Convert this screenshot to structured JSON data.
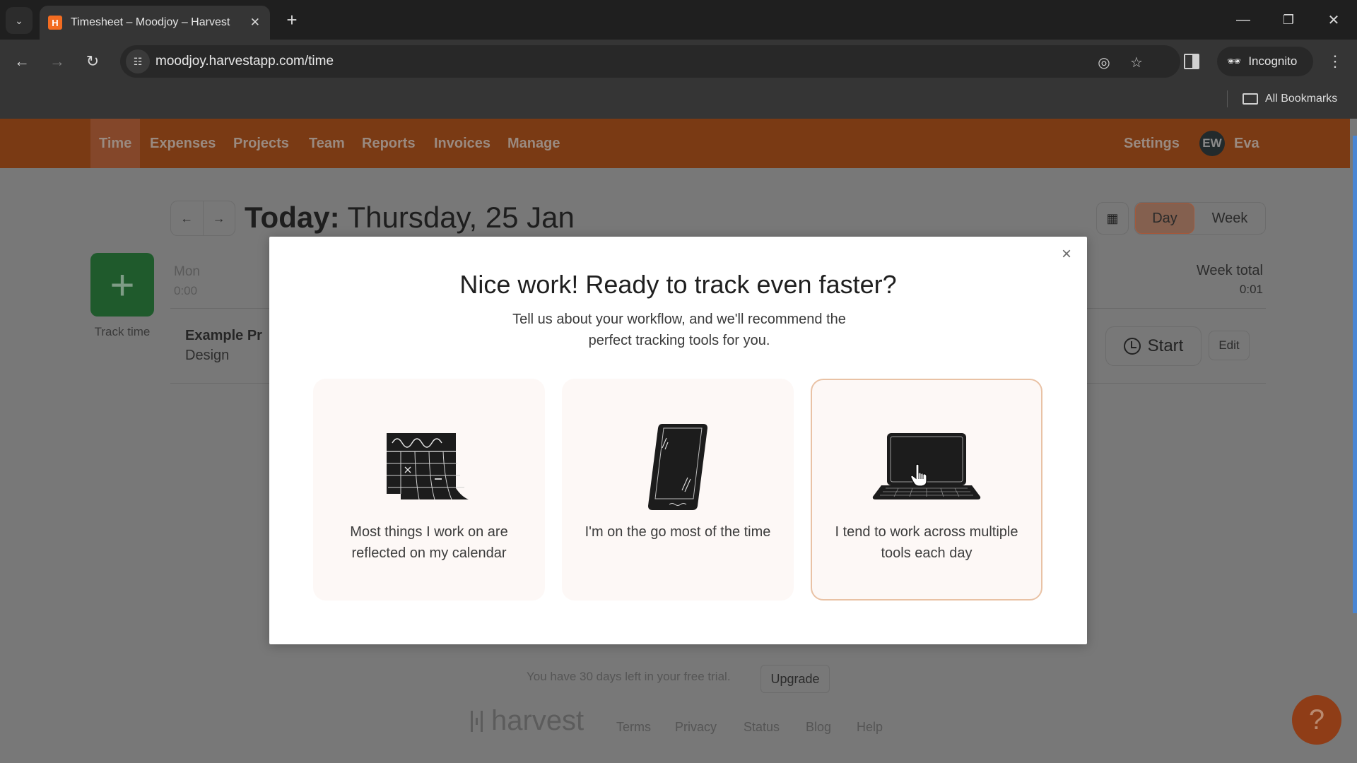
{
  "browser": {
    "tab_title": "Timesheet – Moodjoy – Harvest",
    "favicon_letter": "H",
    "url": "moodjoy.harvestapp.com/time",
    "incognito_label": "Incognito",
    "all_bookmarks_label": "All Bookmarks"
  },
  "app_nav": {
    "items": [
      {
        "label": "Time",
        "active": true
      },
      {
        "label": "Expenses"
      },
      {
        "label": "Projects"
      },
      {
        "label": "Team"
      },
      {
        "label": "Reports"
      },
      {
        "label": "Invoices"
      },
      {
        "label": "Manage"
      }
    ],
    "settings_label": "Settings",
    "user_initials": "EW",
    "user_name": "Eva"
  },
  "timesheet": {
    "date_prefix": "Today:",
    "date_label": "Thursday, 25 Jan",
    "view_options": [
      "Day",
      "Week"
    ],
    "active_view": "Day",
    "track_time_label": "Track time",
    "day_label": "Mon",
    "day_total": "0:00",
    "week_total_label": "Week total",
    "week_total_value": "0:01",
    "entry": {
      "project": "Example Pr",
      "task": "Design",
      "start_label": "Start",
      "edit_label": "Edit"
    }
  },
  "footer": {
    "trial_text": "You have 30 days left in your free trial.",
    "upgrade_label": "Upgrade",
    "logo_text": "harvest",
    "links": [
      "Terms",
      "Privacy",
      "Status",
      "Blog",
      "Help"
    ],
    "help_fab": "?"
  },
  "modal": {
    "title": "Nice work! Ready to track even faster?",
    "subtitle": "Tell us about your workflow, and we'll recommend the perfect tracking tools for you.",
    "close_icon": "×",
    "options": [
      {
        "label": "Most things I work on are reflected on my calendar",
        "icon": "calendar-icon",
        "selected": false
      },
      {
        "label": "I'm on the go most of the time",
        "icon": "phone-icon",
        "selected": false
      },
      {
        "label": "I tend to work across multiple tools each day",
        "icon": "laptop-icon",
        "selected": true
      }
    ]
  },
  "colors": {
    "brand_orange": "#f36c21",
    "nav_dimmed": "#7a3a14",
    "track_green": "#1f5a2c",
    "card_bg": "#fdf8f6",
    "card_selected_border": "#e9c2a5"
  }
}
